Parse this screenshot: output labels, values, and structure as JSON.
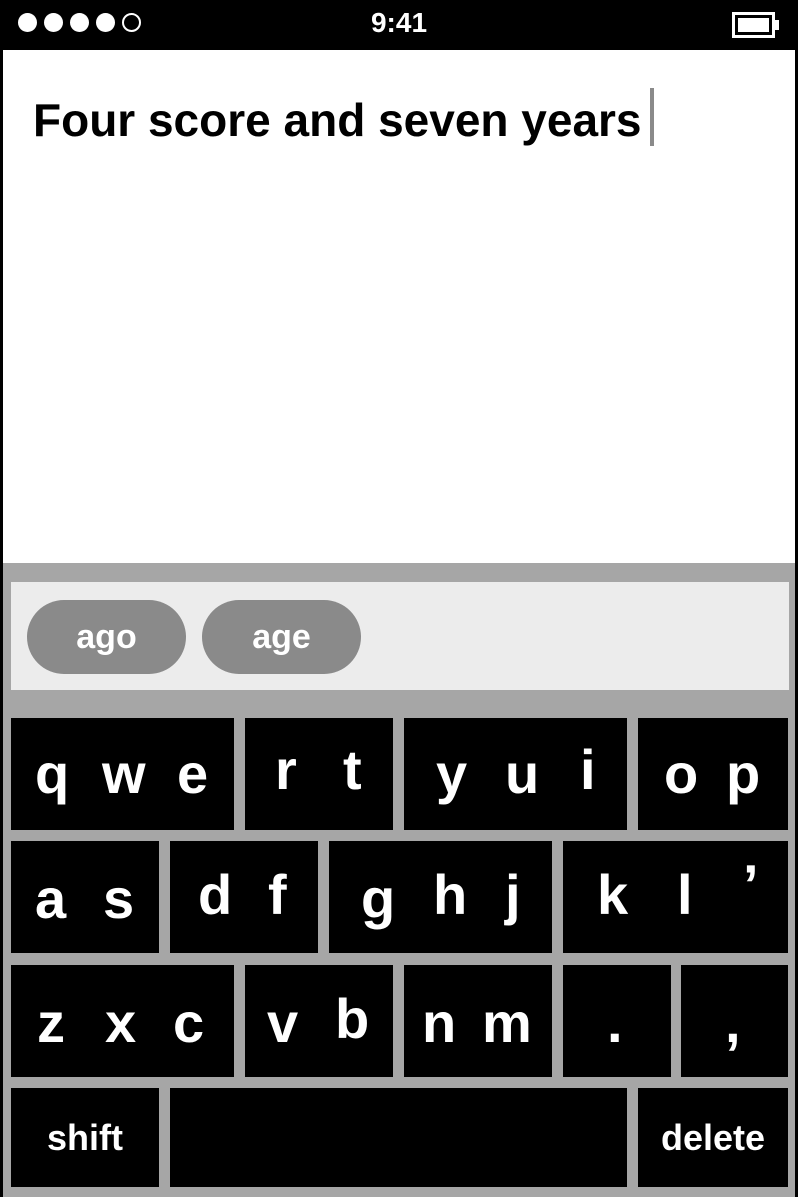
{
  "status_bar": {
    "time": "9:41",
    "signal_dots_filled": 4,
    "signal_dots_total": 5,
    "battery_icon": "battery-icon"
  },
  "document": {
    "text": "Four score and seven years"
  },
  "suggestions": [
    "ago",
    "age"
  ],
  "keys": {
    "row1": [
      [
        "q",
        "w",
        "e"
      ],
      [
        "r",
        "t"
      ],
      [
        "y",
        "u",
        "i"
      ],
      [
        "o",
        "p"
      ]
    ],
    "row2": [
      [
        "a",
        "s"
      ],
      [
        "d",
        "f"
      ],
      [
        "g",
        "h",
        "j"
      ],
      [
        "k",
        "l",
        "’"
      ]
    ],
    "row3": [
      [
        "z",
        "x",
        "c"
      ],
      [
        "v",
        "b"
      ],
      [
        "n",
        "m"
      ],
      [
        "."
      ],
      [
        ","
      ]
    ],
    "shift": "shift",
    "delete": "delete"
  }
}
